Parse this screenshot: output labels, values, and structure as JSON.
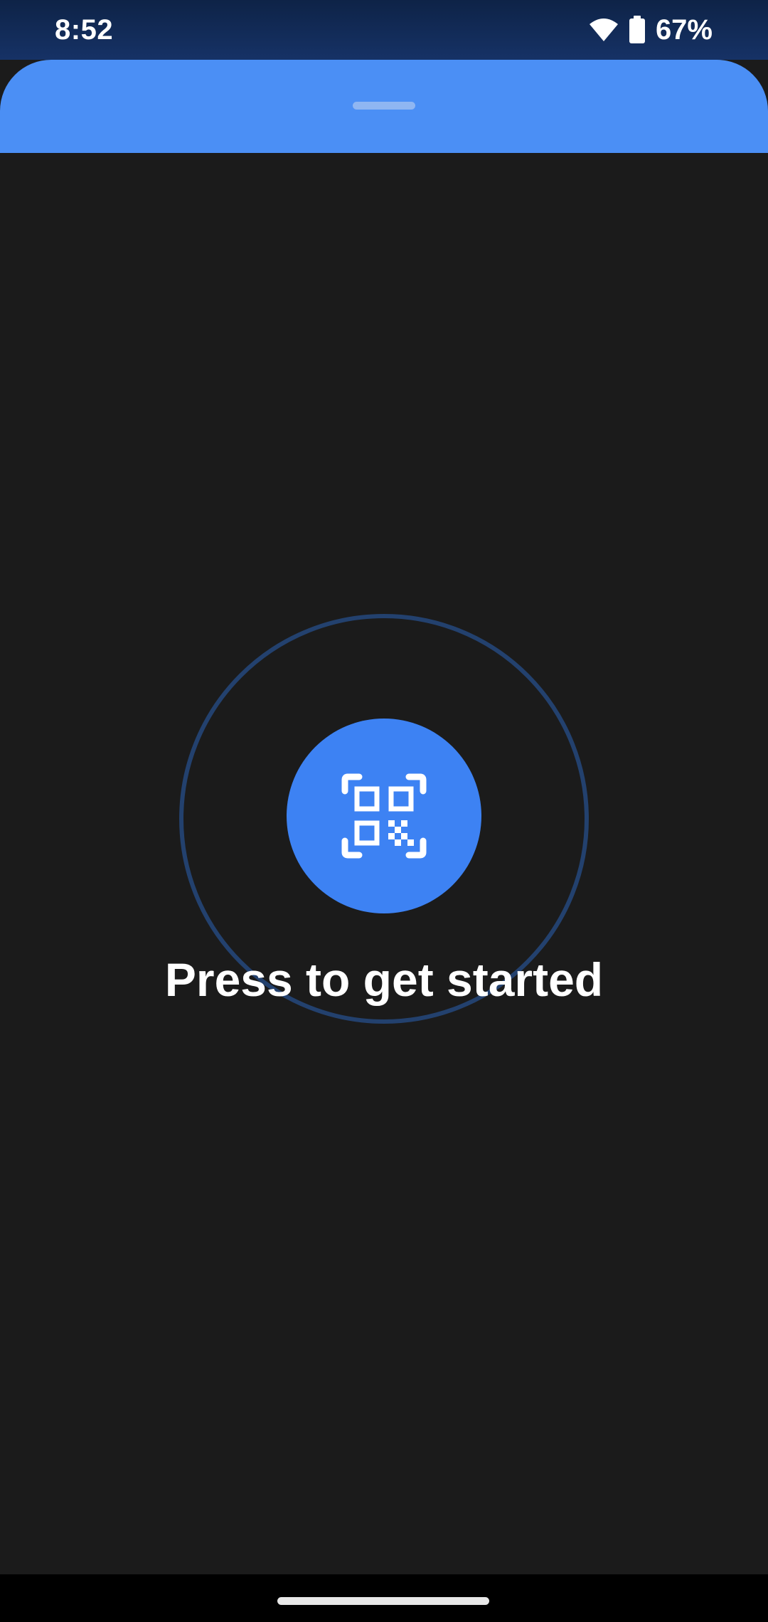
{
  "status_bar": {
    "time": "8:52",
    "battery_percent": "67%",
    "icons": [
      "wifi-icon",
      "battery-icon"
    ]
  },
  "sheet": {
    "accent_color": "#4b8ff5"
  },
  "main": {
    "scan_button_icon": "qr-code-scan-icon",
    "prompt": "Press to get started",
    "button_color": "#3d82f3",
    "ring_color": "#23416e",
    "background_color": "#1b1b1b"
  }
}
